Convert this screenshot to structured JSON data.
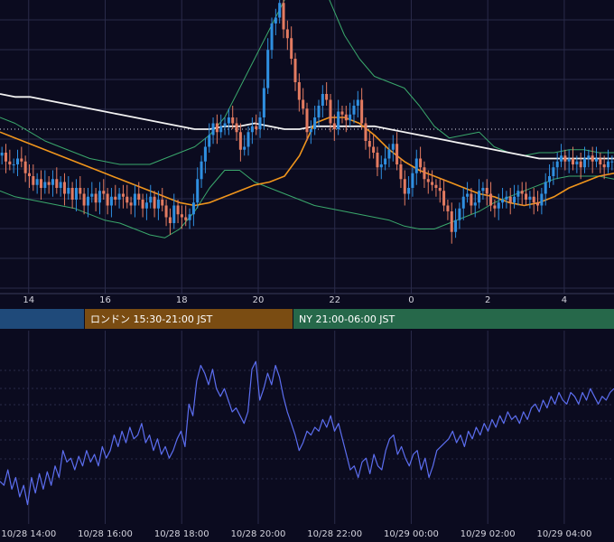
{
  "chart_data": [
    {
      "type": "candlestick",
      "panel": "price",
      "x_axis": {
        "tick_labels": [
          "14",
          "16",
          "18",
          "20",
          "22",
          "0",
          "2",
          "4"
        ],
        "tick_hours": [
          14,
          16,
          18,
          20,
          22,
          24,
          26,
          28
        ],
        "range_hours": [
          13.25,
          29.3
        ]
      },
      "y_axis": {
        "range": [
          0,
          100
        ],
        "grid": true
      },
      "reference_line": {
        "value": 56,
        "style": "dotted"
      },
      "colors": {
        "up": "#2f8fe0",
        "down": "#e37b61",
        "bollinger": "#3aa86c",
        "ma_fast": "#f0951c",
        "ma_slow": "#f2f2f2",
        "grid": "#2a2b4a"
      },
      "candle_closes": [
        48,
        45,
        44,
        44,
        46,
        45,
        41,
        40,
        37,
        39,
        36,
        38,
        37,
        39,
        36,
        38,
        34,
        36,
        32,
        36,
        34,
        30,
        33,
        34,
        31,
        35,
        34,
        30,
        33,
        32,
        34,
        33,
        31,
        30,
        34,
        32,
        29,
        31,
        33,
        29,
        32,
        30,
        26,
        24,
        30,
        27,
        26,
        25,
        27,
        31,
        39,
        45,
        50,
        54,
        58,
        55,
        57,
        58,
        60,
        58,
        55,
        49,
        50,
        55,
        57,
        56,
        60,
        70,
        83,
        92,
        94,
        99,
        90,
        87,
        80,
        72,
        66,
        63,
        55,
        56,
        60,
        64,
        68,
        66,
        58,
        56,
        62,
        61,
        59,
        61,
        64,
        66,
        58,
        52,
        50,
        48,
        43,
        44,
        46,
        49,
        51,
        44,
        39,
        34,
        36,
        41,
        46,
        43,
        39,
        38,
        37,
        36,
        35,
        30,
        28,
        21,
        25,
        29,
        33,
        34,
        30,
        31,
        35,
        36,
        34,
        30,
        29,
        31,
        32,
        33,
        31,
        33,
        35,
        34,
        32,
        33,
        31,
        30,
        34,
        38,
        40,
        43,
        45,
        47,
        45,
        46,
        44,
        45,
        43,
        46,
        47,
        45,
        46,
        44,
        43,
        45,
        45
      ],
      "bollinger_upper": [
        60,
        58,
        55,
        52,
        50,
        48,
        46,
        45,
        44,
        44,
        44,
        46,
        48,
        50,
        54,
        60,
        70,
        80,
        90,
        100,
        110,
        108,
        100,
        88,
        80,
        74,
        72,
        70,
        64,
        57,
        53,
        54,
        55,
        50,
        48,
        47,
        48,
        48,
        49,
        49,
        48,
        48
      ],
      "bollinger_lower": [
        35,
        33,
        32,
        31,
        30,
        29,
        27,
        25,
        24,
        22,
        20,
        19,
        22,
        28,
        36,
        42,
        42,
        38,
        36,
        34,
        32,
        30,
        29,
        28,
        27,
        26,
        25,
        23,
        22,
        22,
        24,
        26,
        28,
        31,
        33,
        35,
        37,
        39,
        40,
        40,
        40,
        39
      ],
      "ma_fast": [
        55,
        53,
        51,
        49,
        47,
        45,
        43,
        41,
        39,
        37,
        35,
        33,
        31,
        30,
        31,
        33,
        35,
        37,
        38,
        40,
        47,
        58,
        60,
        60,
        58,
        54,
        49,
        45,
        42,
        40,
        38,
        36,
        34,
        33,
        31,
        30,
        31,
        33,
        36,
        38,
        40,
        41
      ],
      "ma_slow": [
        68,
        67,
        67,
        66,
        65,
        64,
        63,
        62,
        61,
        60,
        59,
        58,
        57,
        56,
        56,
        57,
        57,
        58,
        57,
        56,
        56,
        57,
        57,
        57,
        57,
        57,
        56,
        55,
        54,
        53,
        52,
        51,
        50,
        49,
        48,
        47,
        46,
        46,
        46,
        46,
        46,
        46
      ]
    },
    {
      "type": "line",
      "panel": "indicator",
      "x_axis": {
        "tick_labels": [
          "10/28 14:00",
          "10/28 16:00",
          "10/28 18:00",
          "10/28 20:00",
          "10/28 22:00",
          "10/29 00:00",
          "10/29 02:00",
          "10/29 04:00"
        ],
        "tick_hours": [
          14,
          16,
          18,
          20,
          22,
          24,
          26,
          28
        ],
        "range_hours": [
          13.25,
          29.3
        ]
      },
      "y_axis": {
        "range": [
          0,
          100
        ],
        "grid": true
      },
      "series": [
        {
          "color": "#5c6ef0",
          "values": [
            22,
            20,
            28,
            18,
            24,
            14,
            20,
            10,
            24,
            16,
            26,
            18,
            27,
            20,
            30,
            24,
            38,
            32,
            34,
            28,
            35,
            30,
            38,
            32,
            36,
            30,
            40,
            34,
            38,
            46,
            40,
            48,
            42,
            50,
            44,
            46,
            52,
            42,
            46,
            38,
            44,
            36,
            40,
            34,
            38,
            44,
            48,
            40,
            62,
            56,
            74,
            82,
            78,
            72,
            80,
            70,
            66,
            70,
            64,
            58,
            60,
            56,
            52,
            58,
            80,
            84,
            64,
            70,
            78,
            72,
            82,
            76,
            66,
            58,
            52,
            46,
            38,
            42,
            48,
            46,
            50,
            48,
            54,
            50,
            56,
            48,
            52,
            44,
            36,
            28,
            30,
            24,
            32,
            34,
            26,
            36,
            30,
            28,
            38,
            44,
            46,
            36,
            40,
            34,
            30,
            36,
            38,
            28,
            34,
            24,
            30,
            38,
            40,
            42,
            44,
            48,
            42,
            46,
            40,
            48,
            44,
            50,
            46,
            52,
            48,
            54,
            50,
            56,
            52,
            58,
            54,
            56,
            52,
            58,
            54,
            60,
            62,
            58,
            64,
            60,
            66,
            62,
            68,
            64,
            62,
            68,
            66,
            62,
            68,
            64,
            70,
            66,
            62,
            66,
            64,
            68,
            70
          ]
        }
      ]
    }
  ],
  "sessions": [
    {
      "label": "",
      "color": "#1f4a7a"
    },
    {
      "label": "ロンドン 15:30-21:00 JST",
      "color": "#7a4c12"
    },
    {
      "label": "NY 21:00-06:00 JST",
      "color": "#26684a"
    }
  ]
}
